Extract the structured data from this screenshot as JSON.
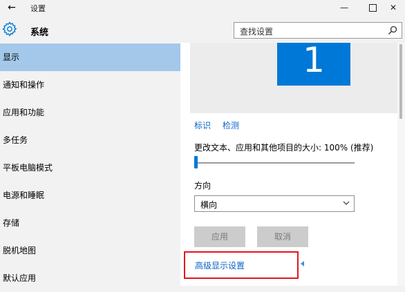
{
  "window": {
    "title": "设置"
  },
  "header": {
    "title": "系统"
  },
  "search": {
    "placeholder": "查找设置"
  },
  "sidebar": {
    "items": [
      {
        "label": "显示",
        "active": true
      },
      {
        "label": "通知和操作"
      },
      {
        "label": "应用和功能"
      },
      {
        "label": "多任务"
      },
      {
        "label": "平板电脑模式"
      },
      {
        "label": "电源和睡眠"
      },
      {
        "label": "存储"
      },
      {
        "label": "脱机地图"
      },
      {
        "label": "默认应用"
      }
    ]
  },
  "display": {
    "monitor_number": "1",
    "identify_link": "标识",
    "detect_link": "检测",
    "scale_label": "更改文本、应用和其他项目的大小: 100% (推荐)",
    "scale_value_percent": 100,
    "orientation_label": "方向",
    "orientation_value": "横向",
    "apply_button": "应用",
    "cancel_button": "取消",
    "advanced_link": "高级显示设置"
  },
  "colors": {
    "accent": "#0078d7",
    "active_nav": "#a3c8ea",
    "highlight_border": "#e0171f",
    "link": "#0a64c8"
  }
}
